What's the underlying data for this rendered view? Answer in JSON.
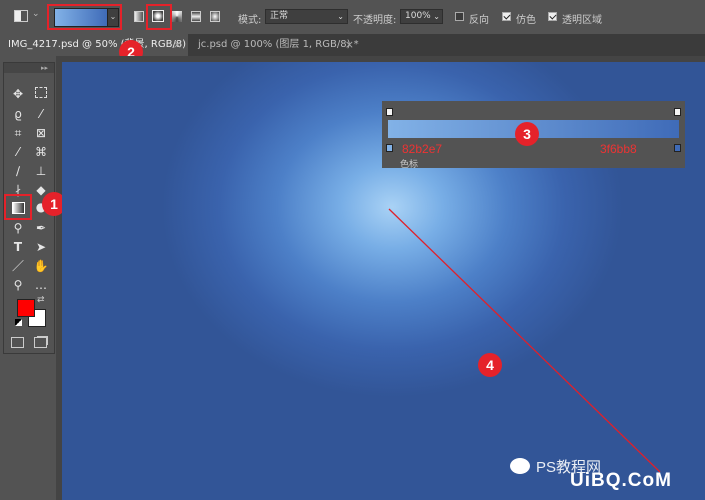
{
  "options_bar": {
    "mode_label": "模式:",
    "mode_value": "正常",
    "opacity_label": "不透明度:",
    "opacity_value": "100%",
    "reverse_label": "反向",
    "reverse_checked": false,
    "dither_label": "仿色",
    "dither_checked": true,
    "transparency_label": "透明区域",
    "transparency_checked": true,
    "gradient_start": "#82b2e7",
    "gradient_end": "#3f6bb8"
  },
  "tabs": [
    {
      "label": "IMG_4217.psd @ 50% (背景, RGB/8) *",
      "active": true
    },
    {
      "label": "jc.psd @ 100% (图层 1, RGB/8) *",
      "active": false
    }
  ],
  "toolbox": {
    "foreground_color": "#ff0000",
    "background_color": "#ffffff",
    "tools": [
      "move-tool",
      "marquee-tool",
      "lasso-tool",
      "magic-wand-tool",
      "crop-tool",
      "frame-tool",
      "eyedropper-tool",
      "healing-brush-tool",
      "brush-tool",
      "stamp-tool",
      "history-brush-tool",
      "eraser-tool",
      "gradient-tool",
      "blur-tool",
      "dodge-tool",
      "pen-tool",
      "type-tool",
      "path-select-tool",
      "line-tool",
      "hand-tool",
      "zoom-tool",
      "more-tools"
    ]
  },
  "gradient_editor": {
    "left_color": "#82b2e7",
    "right_color": "#3f6bb8",
    "left_hex": "82b2e7",
    "right_hex": "3f6bb8",
    "label": "色标"
  },
  "annotations": [
    "1",
    "2",
    "3",
    "4"
  ],
  "watermark": {
    "text": "PS教程网",
    "brand": "UiBQ.CoM"
  }
}
